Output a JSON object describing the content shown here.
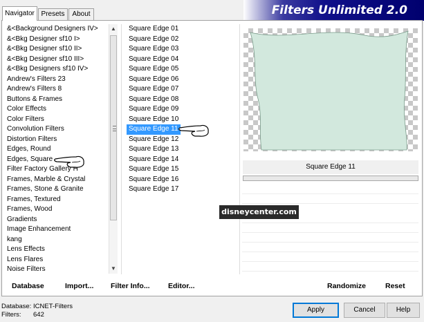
{
  "tabs": [
    {
      "label": "Navigator",
      "active": true
    },
    {
      "label": "Presets",
      "active": false
    },
    {
      "label": "About",
      "active": false
    }
  ],
  "banner": {
    "title": "Filters Unlimited 2.0"
  },
  "categories": [
    "&<Background Designers IV>",
    "&<Bkg Designer sf10 I>",
    "&<Bkg Designer sf10 II>",
    "&<Bkg Designer sf10 III>",
    "&<Bkg Designers sf10 IV>",
    "Andrew's Filters 23",
    "Andrew's Filters 8",
    "Buttons & Frames",
    "Color Effects",
    "Color Filters",
    "Convolution Filters",
    "Distortion Filters",
    "Edges, Round",
    "Edges, Square",
    "Filter Factory Gallery H",
    "Frames, Marble & Crystal",
    "Frames, Stone & Granite",
    "Frames, Textured",
    "Frames, Wood",
    "Gradients",
    "Image Enhancement",
    "kang",
    "Lens Effects",
    "Lens Flares",
    "Noise Filters"
  ],
  "filters": [
    "Square Edge 01",
    "Square Edge 02",
    "Square Edge 03",
    "Square Edge 04",
    "Square Edge 05",
    "Square Edge 06",
    "Square Edge 07",
    "Square Edge 08",
    "Square Edge 09",
    "Square Edge 10",
    "Square Edge 11",
    "Square Edge 12",
    "Square Edge 13",
    "Square Edge 14",
    "Square Edge 15",
    "Square Edge 16",
    "Square Edge 17"
  ],
  "selected_filter_index": 10,
  "preview": {
    "filter_name": "Square Edge 11",
    "fill_color": "#d2e8dd",
    "checker_color": "#c8c8c8"
  },
  "watermark": {
    "text": "disneycenter.com"
  },
  "toolbar": {
    "database": "Database",
    "import": "Import...",
    "filter_info": "Filter Info...",
    "editor": "Editor...",
    "randomize": "Randomize",
    "reset": "Reset"
  },
  "info": {
    "database_label": "Database:",
    "database_value": "ICNET-Filters",
    "filters_label": "Filters:",
    "filters_value": "642"
  },
  "buttons": {
    "apply": "Apply",
    "cancel": "Cancel",
    "help": "Help"
  },
  "colors": {
    "banner": "#00006e",
    "selection": "#3399ff"
  },
  "icons": {
    "pointer": "pointing-hand-icon",
    "scroll_up": "arrow-up-icon",
    "scroll_down": "arrow-down-icon"
  }
}
